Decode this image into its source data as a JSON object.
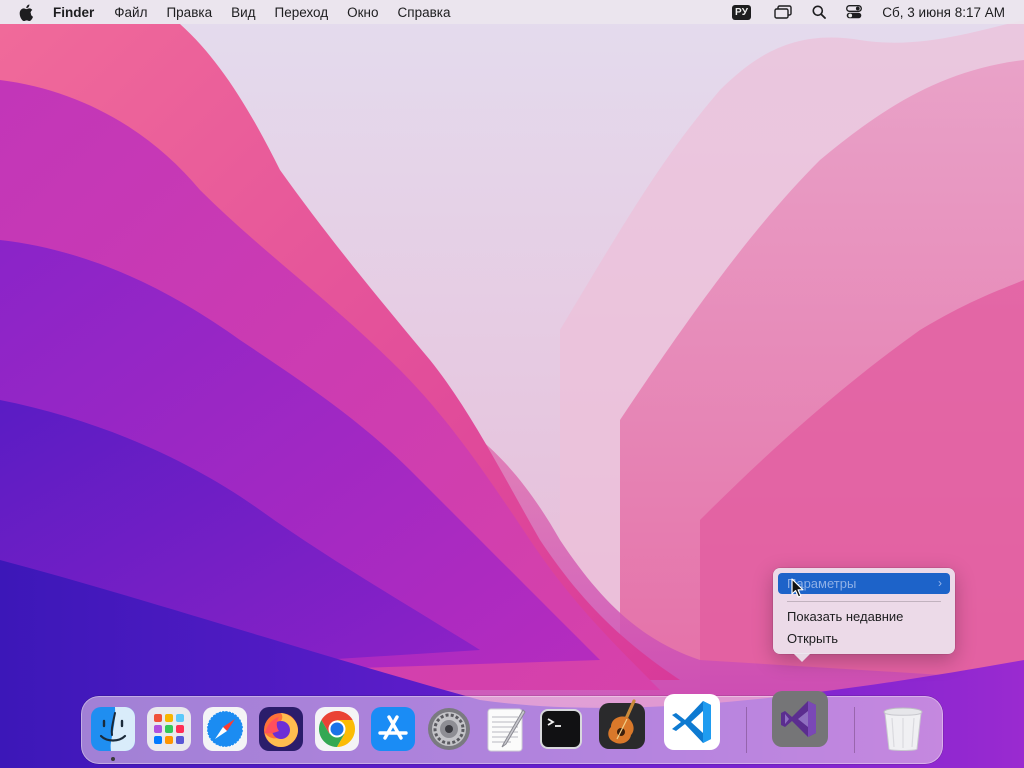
{
  "menubar": {
    "app_name": "Finder",
    "menus": [
      "Файл",
      "Правка",
      "Вид",
      "Переход",
      "Окно",
      "Справка"
    ],
    "input_language": "РУ",
    "datetime": "Сб, 3 июня  8:17 AM"
  },
  "context_menu": {
    "items": [
      {
        "label": "Параметры",
        "has_submenu": true,
        "highlighted": true
      },
      {
        "label": "Показать недавние",
        "has_submenu": false
      },
      {
        "label": "Открыть",
        "has_submenu": false
      }
    ]
  },
  "dock": {
    "apps": [
      {
        "icon": "finder-icon",
        "running": true
      },
      {
        "icon": "launchpad-icon"
      },
      {
        "icon": "safari-icon"
      },
      {
        "icon": "firefox-icon"
      },
      {
        "icon": "chrome-icon"
      },
      {
        "icon": "app-store-icon"
      },
      {
        "icon": "system-settings-icon"
      },
      {
        "icon": "textedit-icon"
      },
      {
        "icon": "terminal-icon"
      },
      {
        "icon": "garageband-icon"
      },
      {
        "icon": "vscode-icon"
      }
    ],
    "recent_apps": [
      {
        "icon": "visual-studio-icon"
      }
    ],
    "trash": {
      "icon": "trash-icon"
    }
  },
  "colors": {
    "menu_highlight": "#1d63c9",
    "wallpaper_magenta": "#d63aa8",
    "wallpaper_purple": "#6a1fd0"
  }
}
